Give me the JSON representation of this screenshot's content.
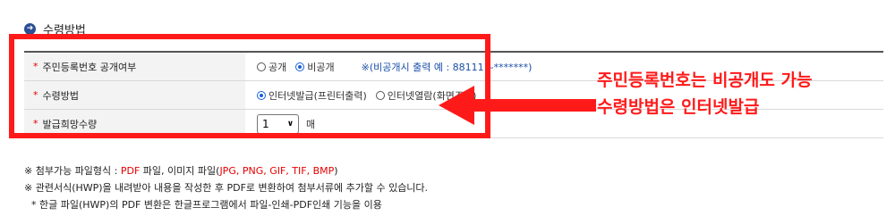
{
  "section": {
    "title": "수령방법"
  },
  "rows": [
    {
      "required_mark": "*",
      "label": "주민등록번호 공개여부",
      "options": [
        "공개",
        "비공개"
      ],
      "selected_index": 1,
      "note": "※(비공개시 출력 예 : 881111-*******)"
    },
    {
      "required_mark": "*",
      "label": "수령방법",
      "options": [
        "인터넷발급(프린터출력)",
        "인터넷열람(화면조회)"
      ],
      "selected_index": 0
    },
    {
      "required_mark": "*",
      "label": "발급희망수량",
      "select_value": "1",
      "unit": "매"
    }
  ],
  "annotation": {
    "line1": "주민등록번호는 비공개도 가능",
    "line2": "수령방법은 인터넷발급",
    "color": "#ff1a1a"
  },
  "notes": {
    "line1_prefix": "※ 첨부가능 파일형식 : ",
    "line1_pdf": "PDF",
    "line1_mid": " 파일, 이미지 파일(",
    "line1_imgs": "JPG, PNG, GIF, TIF, BMP",
    "line1_suffix": ")",
    "line2": "※ 관련서식(HWP)을 내려받아 내용을 작성한 후 PDF로 변환하여 첨부서류에 추가할 수 있습니다.",
    "line3": "* 한글 파일(HWP)의 PDF 변환은 한글프로그램에서 파일-인쇄-PDF인쇄 기능을 이용"
  }
}
